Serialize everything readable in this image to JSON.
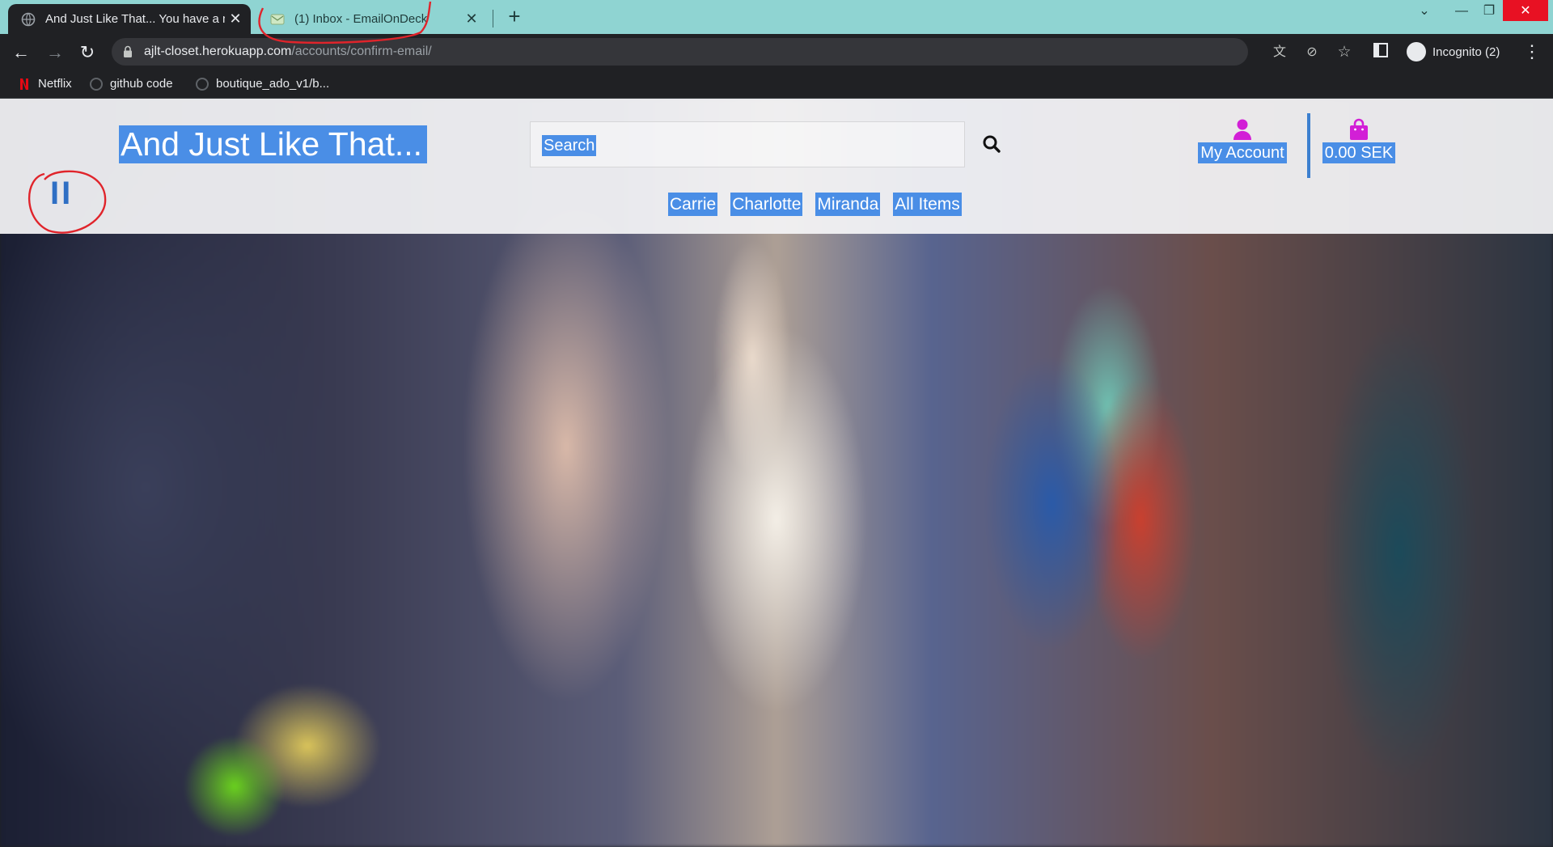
{
  "browser": {
    "tabs": [
      {
        "title": "And Just Like That... You have a n",
        "active": true
      },
      {
        "title": "(1) Inbox - EmailOnDeck",
        "active": false
      }
    ],
    "url_host": "ajlt-closet.herokuapp.com",
    "url_path": "/accounts/confirm-email/",
    "profile_label": "Incognito (2)",
    "bookmarks": [
      "Netflix",
      "github code",
      "boutique_ado_v1/b..."
    ]
  },
  "site": {
    "logo": "And Just Like That...",
    "search_placeholder": "Search",
    "account_label": "My Account",
    "bag_total": "0.00 SEK",
    "nav": [
      "Carrie",
      "Charlotte",
      "Miranda",
      "All Items"
    ],
    "pause_glyph": "II"
  },
  "colors": {
    "tabbar": "#8fd4d2",
    "selection": "#4a8ee6",
    "accent_magenta": "#d21fd6",
    "annotation_red": "#e0242b"
  },
  "icons": [
    "globe-icon",
    "emailondeck-icon",
    "close-icon",
    "plus-icon",
    "back-icon",
    "forward-icon",
    "reload-icon",
    "lock-icon",
    "translate-icon",
    "eye-off-icon",
    "star-icon",
    "sidepanel-icon",
    "incognito-icon",
    "netflix-icon",
    "github-icon",
    "search-icon",
    "user-icon",
    "shopping-bag-icon",
    "pause-icon"
  ]
}
